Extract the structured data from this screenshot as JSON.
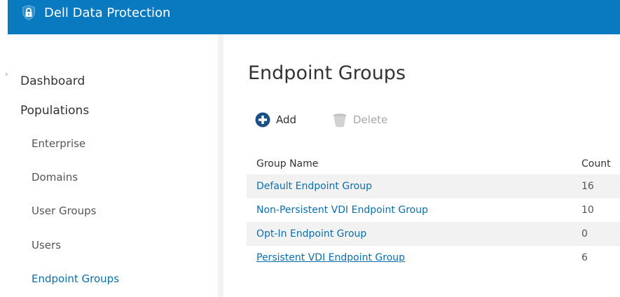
{
  "header": {
    "title": "Dell Data Protection",
    "icon": "lock-icon",
    "background": "#0a7ac0"
  },
  "sidebar": {
    "dashboard": "Dashboard",
    "populations": "Populations",
    "items": [
      {
        "label": "Enterprise",
        "active": false
      },
      {
        "label": "Domains",
        "active": false
      },
      {
        "label": "User Groups",
        "active": false
      },
      {
        "label": "Users",
        "active": false
      },
      {
        "label": "Endpoint Groups",
        "active": true
      }
    ]
  },
  "main": {
    "title": "Endpoint Groups",
    "toolbar": {
      "add_label": "Add",
      "add_icon": "plus-circle-icon",
      "delete_label": "Delete",
      "delete_icon": "trash-icon"
    },
    "table": {
      "columns": [
        "Group Name",
        "Count"
      ],
      "rows": [
        {
          "name": "Default Endpoint Group",
          "count": "16"
        },
        {
          "name": "Non-Persistent VDI Endpoint Group",
          "count": "10"
        },
        {
          "name": "Opt-In Endpoint Group",
          "count": "0"
        },
        {
          "name": "Persistent VDI Endpoint Group",
          "count": "6"
        }
      ]
    }
  },
  "colors": {
    "accent": "#0a7ac0",
    "link": "#0a6fae",
    "row_alt": "#f2f2f2"
  }
}
